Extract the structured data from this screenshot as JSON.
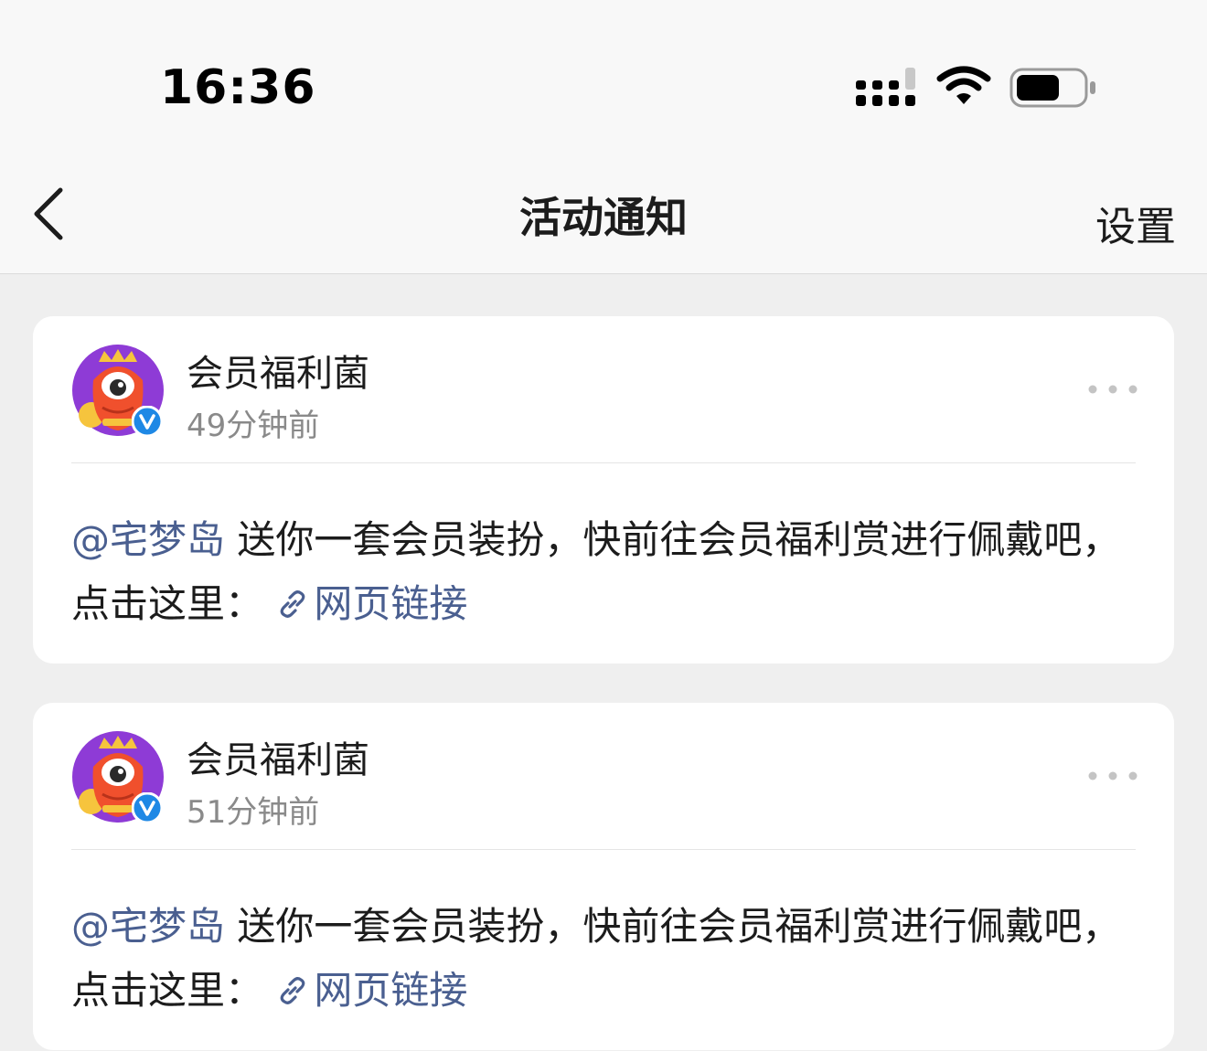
{
  "status_bar": {
    "time": "16:36"
  },
  "nav": {
    "title": "活动通知",
    "settings_label": "设置"
  },
  "colors": {
    "link": "#4a5f90",
    "verified_badge": "#1e88e5",
    "avatar_bg": "#8e3bd6",
    "avatar_mascot": "#f0502d"
  },
  "notifications": [
    {
      "sender": "会员福利菌",
      "time": "49分钟前",
      "mention": "@宅梦岛",
      "text_part1": " 送你一套会员装扮，快前往会员福利赏进行佩戴吧，点击这里：",
      "link_label": "网页链接",
      "avatar_icon": "monster-mascot-avatar",
      "verified": true
    },
    {
      "sender": "会员福利菌",
      "time": "51分钟前",
      "mention": "@宅梦岛",
      "text_part1": " 送你一套会员装扮，快前往会员福利赏进行佩戴吧，点击这里：",
      "link_label": "网页链接",
      "avatar_icon": "monster-mascot-avatar",
      "verified": true
    }
  ]
}
